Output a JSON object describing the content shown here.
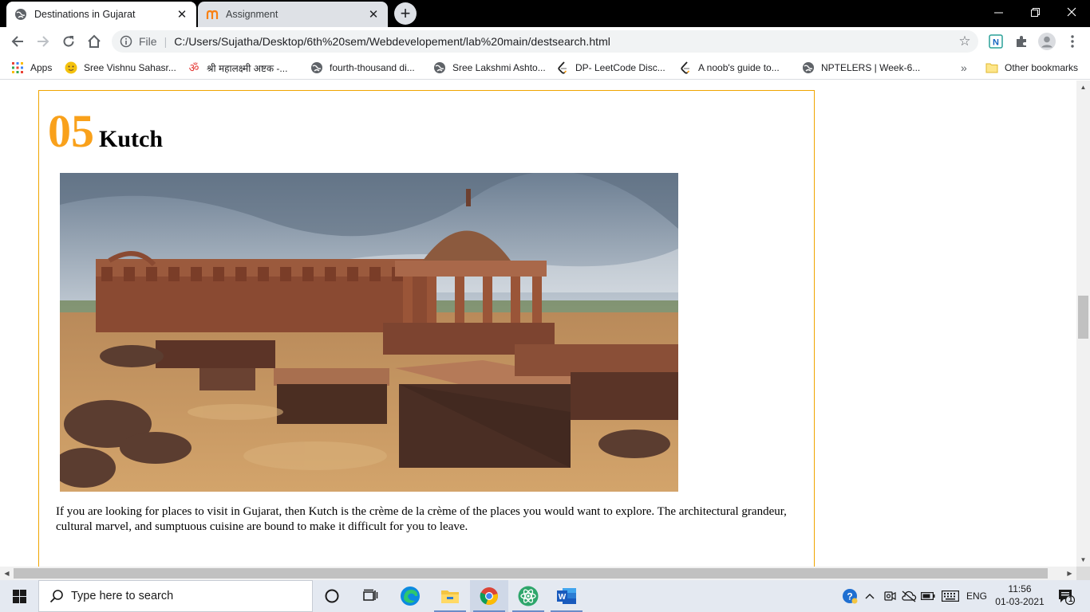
{
  "browser": {
    "tabs": [
      {
        "title": "Destinations in Gujarat",
        "active": true,
        "icon": "globe-icon"
      },
      {
        "title": "Assignment",
        "active": false,
        "icon": "moodle-icon"
      }
    ],
    "new_tab": "+",
    "window_controls": {
      "minimize": "—",
      "restore": "❐",
      "close": "✕"
    },
    "toolbar": {
      "scheme": "File",
      "url": "C:/Users/Sujatha/Desktop/6th%20sem/Webdevelopement/lab%20main/destsearch.html",
      "bookmark_star": "☆",
      "extensions": [
        "nptel-extension-icon",
        "puzzle-icon",
        "profile-avatar-icon",
        "kebab-menu-icon"
      ]
    },
    "bookmarks": {
      "apps_label": "Apps",
      "items": [
        {
          "label": "Sree Vishnu Sahasr...",
          "icon": "emoji-face-icon"
        },
        {
          "label": "श्री महालक्ष्मी अष्टक -...",
          "icon": "om-icon"
        },
        {
          "label": "fourth-thousand di...",
          "icon": "globe-icon"
        },
        {
          "label": "Sree Lakshmi Ashto...",
          "icon": "globe-icon"
        },
        {
          "label": "DP- LeetCode Disc...",
          "icon": "leetcode-icon"
        },
        {
          "label": "A noob's guide to...",
          "icon": "leetcode-icon"
        },
        {
          "label": "NPTELERS | Week-6...",
          "icon": "globe-icon"
        }
      ],
      "overflow": "»",
      "other_bookmarks": "Other bookmarks"
    }
  },
  "page": {
    "number": "05",
    "name": "Kutch",
    "description": "If you are looking for places to visit in Gujarat, then Kutch is the crème de la crème of the places you would want to explore. The architectural grandeur, cultural marvel, and sumptuous cuisine are bound to make it difficult for you to leave.",
    "image_alt": "Kutch ruins",
    "accent_color": "#f9a11b",
    "border_color": "#f0a500"
  },
  "taskbar": {
    "search_placeholder": "Type here to search",
    "apps": [
      "cortana-icon",
      "task-view-icon",
      "edge-icon",
      "file-explorer-icon",
      "chrome-icon",
      "atom-icon",
      "word-icon"
    ],
    "language": "ENG",
    "time": "11:56",
    "date": "01-03-2021",
    "notification_count": "1"
  }
}
